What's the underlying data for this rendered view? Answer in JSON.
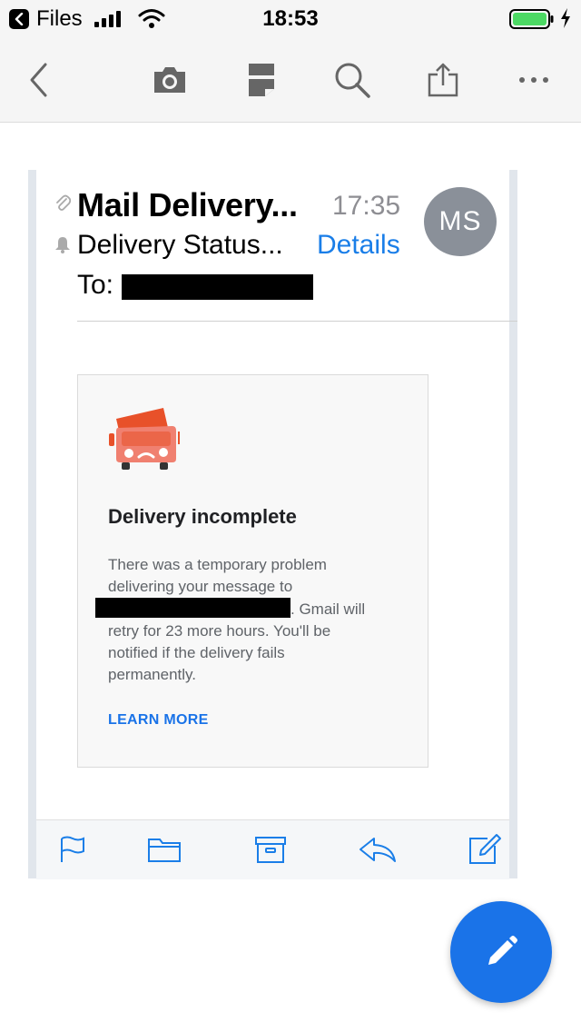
{
  "status_bar": {
    "back_app": "Files",
    "time": "18:53"
  },
  "toolbar": {
    "icons": [
      "back-icon",
      "camera-icon",
      "document-icon",
      "search-icon",
      "share-icon",
      "more-icon"
    ]
  },
  "message": {
    "sender": "Mail Delivery...",
    "time": "17:35",
    "avatar_initials": "MS",
    "subject": "Delivery Status...",
    "details_link": "Details",
    "to_label": "To:"
  },
  "notice": {
    "title": "Delivery incomplete",
    "body_line1": "There was a temporary problem",
    "body_line2": "delivering your message to",
    "body_line3_after": ". Gmail will",
    "body_line4": "retry for 23 more hours. You'll be",
    "body_line5": "notified if the delivery fails",
    "body_line6": "permanently.",
    "learn_more": "LEARN MORE"
  },
  "bottom_bar": {
    "icons": [
      "flag-icon",
      "folder-icon",
      "archive-icon",
      "reply-icon",
      "compose-icon"
    ]
  },
  "colors": {
    "accent": "#1a7ee8",
    "fab": "#1a73e8",
    "truck": "#e8512a",
    "avatar": "#8a9099"
  }
}
